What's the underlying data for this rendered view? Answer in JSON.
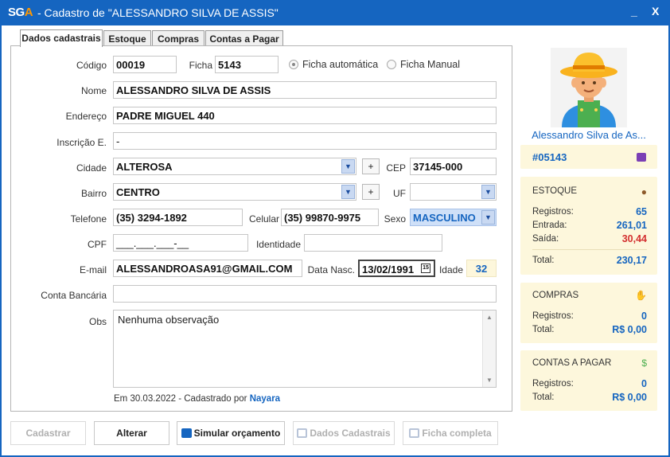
{
  "window": {
    "logo_s": "SG",
    "logo_a": "A",
    "title": " - Cadastro de \"ALESSANDRO SILVA DE ASSIS\"",
    "minimize": "_",
    "close": "X"
  },
  "tabs": [
    "Dados cadastrais",
    "Estoque",
    "Compras",
    "Contas a Pagar"
  ],
  "form": {
    "codigo_label": "Código",
    "codigo": "00019",
    "ficha_label": "Ficha",
    "ficha": "5143",
    "ficha_auto": "Ficha automática",
    "ficha_manual": "Ficha Manual",
    "nome_label": "Nome",
    "nome": "ALESSANDRO SILVA DE ASSIS",
    "endereco_label": "Endereço",
    "endereco": "PADRE MIGUEL 440",
    "inscricao_label": "Inscrição E.",
    "inscricao": "-",
    "cidade_label": "Cidade",
    "cidade": "ALTEROSA",
    "plus": "+",
    "cep_label": "CEP",
    "cep": "37145-000",
    "bairro_label": "Bairro",
    "bairro": "CENTRO",
    "uf_label": "UF",
    "uf": "",
    "telefone_label": "Telefone",
    "telefone": "(35) 3294-1892",
    "celular_label": "Celular",
    "celular": "(35) 99870-9975",
    "sexo_label": "Sexo",
    "sexo": "MASCULINO",
    "cpf_label": "CPF",
    "cpf": "___.___.___-__",
    "identidade_label": "Identidade",
    "identidade": "",
    "email_label": "E-mail",
    "email": "ALESSANDROASA91@GMAIL.COM",
    "datanasc_label": "Data Nasc.",
    "datanasc": "13/02/1991",
    "idade_label": "Idade",
    "idade": "32",
    "conta_label": "Conta Bancária",
    "conta": "",
    "obs_label": "Obs",
    "obs": "Nenhuma observação",
    "footer_prefix": "Em 30.03.2022 - Cadastrado por",
    "footer_user": "Nayara"
  },
  "buttons": {
    "cadastrar": "Cadastrar",
    "alterar": "Alterar",
    "simular": "Simular orçamento",
    "dados": "Dados Cadastrais",
    "ficha": "Ficha completa"
  },
  "sidebar": {
    "name": "Alessandro Silva de As...",
    "id": "#05143",
    "estoque": {
      "title": "ESTOQUE",
      "registros_label": "Registros:",
      "registros": "65",
      "entrada_label": "Entrada:",
      "entrada": "261,01",
      "saida_label": "Saída:",
      "saida": "30,44",
      "total_label": "Total:",
      "total": "230,17"
    },
    "compras": {
      "title": "COMPRAS",
      "registros_label": "Registros:",
      "registros": "0",
      "total_label": "Total:",
      "total": "R$ 0,00"
    },
    "contas": {
      "title": "CONTAS A PAGAR",
      "registros_label": "Registros:",
      "registros": "0",
      "total_label": "Total:",
      "total": "R$ 0,00"
    }
  },
  "colors": {
    "window_blue": "#1565c0",
    "accent_orange": "#ff9800",
    "value_blue": "#1565c0",
    "value_red": "#d32f2f",
    "card_bg": "#fdf7dc"
  }
}
